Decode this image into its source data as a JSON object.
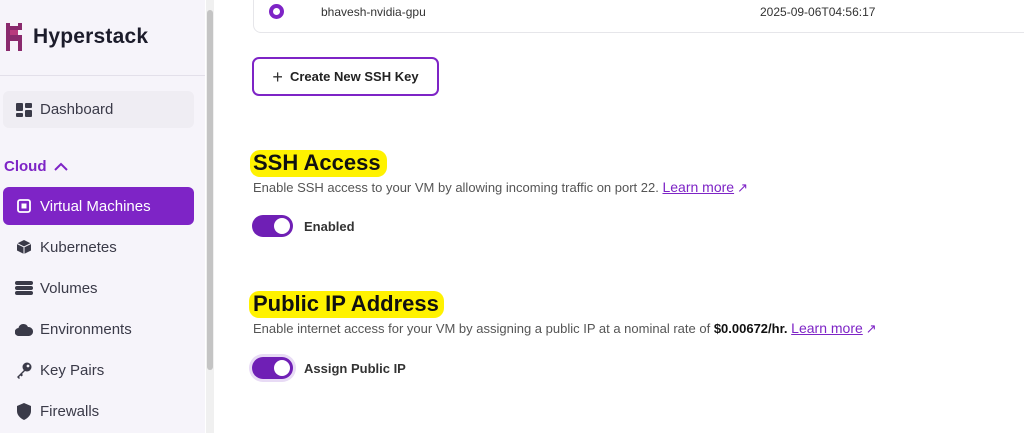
{
  "brand": {
    "name": "Hyperstack"
  },
  "sidebar": {
    "dashboard": {
      "label": "Dashboard",
      "icon": "dashboard-icon"
    },
    "group": {
      "label": "Cloud",
      "icon": "chevron-up-icon"
    },
    "items": [
      {
        "label": "Virtual Machines",
        "icon": "chip-icon",
        "active": true
      },
      {
        "label": "Kubernetes",
        "icon": "cube-icon",
        "active": false
      },
      {
        "label": "Volumes",
        "icon": "database-icon",
        "active": false
      },
      {
        "label": "Environments",
        "icon": "cloud-icon",
        "active": false
      },
      {
        "label": "Key Pairs",
        "icon": "key-icon",
        "active": false
      },
      {
        "label": "Firewalls",
        "icon": "shield-icon",
        "active": false
      }
    ]
  },
  "ssh_key_row": {
    "name": "bhavesh-nvidia-gpu",
    "created": "2025-09-06T04:56:17"
  },
  "create_button": {
    "label": "Create New SSH Key"
  },
  "ssh_access": {
    "title": "SSH Access",
    "description": "Enable SSH access to your VM by allowing incoming traffic on port 22.",
    "link": "Learn more",
    "toggle_label": "Enabled",
    "toggle_on": true
  },
  "public_ip": {
    "title": "Public IP Address",
    "description_prefix": "Enable internet access for your VM by assigning a public IP at a nominal rate of",
    "rate": "$0.00672/hr.",
    "link": "Learn more",
    "toggle_label": "Assign Public IP",
    "toggle_on": true
  },
  "colors": {
    "accent": "#7e24c6",
    "highlight": "#fff200"
  }
}
